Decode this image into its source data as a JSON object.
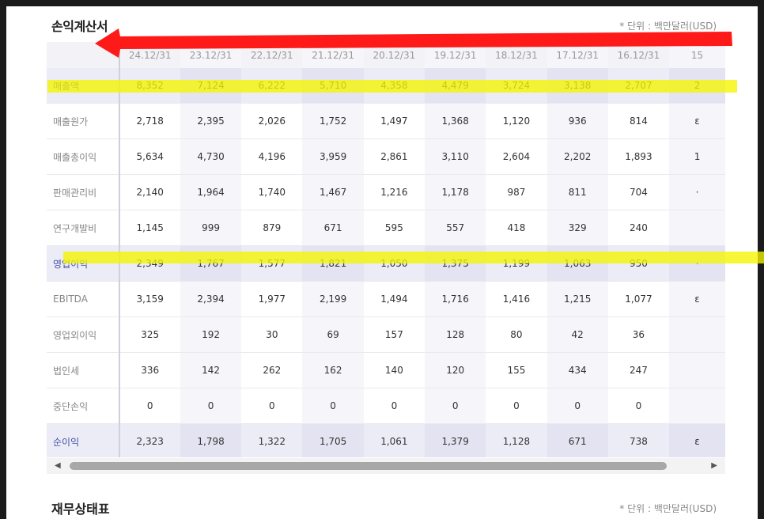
{
  "income_statement": {
    "title": "손익계산서",
    "unit_note": "* 단위 : 백만달러(USD)",
    "columns": [
      "24.12/31",
      "23.12/31",
      "22.12/31",
      "21.12/31",
      "20.12/31",
      "19.12/31",
      "18.12/31",
      "17.12/31",
      "16.12/31",
      "15"
    ],
    "rows": [
      {
        "label": "매출액",
        "values": [
          "8,352",
          "7,124",
          "6,222",
          "5,710",
          "4,358",
          "4,479",
          "3,724",
          "3,138",
          "2,707",
          "2"
        ]
      },
      {
        "label": "매출원가",
        "values": [
          "2,718",
          "2,395",
          "2,026",
          "1,752",
          "1,497",
          "1,368",
          "1,120",
          "936",
          "814",
          "ε"
        ]
      },
      {
        "label": "매출총이익",
        "values": [
          "5,634",
          "4,730",
          "4,196",
          "3,959",
          "2,861",
          "3,110",
          "2,604",
          "2,202",
          "1,893",
          "1"
        ]
      },
      {
        "label": "판매관리비",
        "values": [
          "2,140",
          "1,964",
          "1,740",
          "1,467",
          "1,216",
          "1,178",
          "987",
          "811",
          "704",
          "·"
        ]
      },
      {
        "label": "연구개발비",
        "values": [
          "1,145",
          "999",
          "879",
          "671",
          "595",
          "557",
          "418",
          "329",
          "240",
          ""
        ]
      },
      {
        "label": "영업이익",
        "values": [
          "2,349",
          "1,767",
          "1,577",
          "1,821",
          "1,050",
          "1,375",
          "1,199",
          "1,063",
          "950",
          "·"
        ]
      },
      {
        "label": "EBITDA",
        "values": [
          "3,159",
          "2,394",
          "1,977",
          "2,199",
          "1,494",
          "1,716",
          "1,416",
          "1,215",
          "1,077",
          "ε"
        ]
      },
      {
        "label": "영업외이익",
        "values": [
          "325",
          "192",
          "30",
          "69",
          "157",
          "128",
          "80",
          "42",
          "36",
          ""
        ]
      },
      {
        "label": "법인세",
        "values": [
          "336",
          "142",
          "262",
          "162",
          "140",
          "120",
          "155",
          "434",
          "247",
          ""
        ]
      },
      {
        "label": "중단손익",
        "values": [
          "0",
          "0",
          "0",
          "0",
          "0",
          "0",
          "0",
          "0",
          "0",
          ""
        ]
      },
      {
        "label": "순이익",
        "values": [
          "2,323",
          "1,798",
          "1,322",
          "1,705",
          "1,061",
          "1,379",
          "1,128",
          "671",
          "738",
          "ε"
        ]
      }
    ]
  },
  "balance_sheet": {
    "title": "재무상태표",
    "unit_note": "* 단위 : 백만달러(USD)"
  },
  "scrollbar": {
    "left_arrow": "◀",
    "right_arrow": "▶"
  },
  "colors": {
    "accent_label": "#4451a8",
    "highlight": "#f5f500",
    "arrow": "#ff1a1a"
  }
}
